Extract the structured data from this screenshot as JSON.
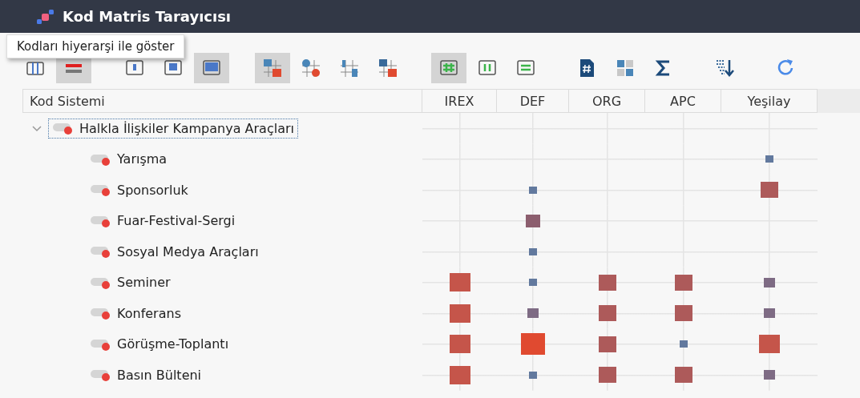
{
  "window": {
    "title": "Kod Matris Tarayıcısı"
  },
  "tooltip": "Kodları hiyerarşi ile göster",
  "toolbar": [
    {
      "kind": "columns",
      "selected": false
    },
    {
      "kind": "redlines",
      "selected": true
    },
    {
      "kind": "gap"
    },
    {
      "kind": "sq1",
      "selected": false
    },
    {
      "kind": "sq2",
      "selected": false
    },
    {
      "kind": "sq3",
      "selected": true
    },
    {
      "kind": "gap"
    },
    {
      "kind": "squares",
      "selected": true
    },
    {
      "kind": "circles",
      "selected": false
    },
    {
      "kind": "numbers",
      "selected": false
    },
    {
      "kind": "numsq",
      "selected": false
    },
    {
      "kind": "gap"
    },
    {
      "kind": "hash",
      "selected": true
    },
    {
      "kind": "pause",
      "selected": false
    },
    {
      "kind": "equals",
      "selected": false
    },
    {
      "kind": "gap"
    },
    {
      "kind": "doc",
      "selected": false
    },
    {
      "kind": "grid",
      "selected": false
    },
    {
      "kind": "sigma",
      "selected": false
    },
    {
      "kind": "gap"
    },
    {
      "kind": "sort",
      "selected": false
    },
    {
      "kind": "gap"
    },
    {
      "kind": "refresh",
      "selected": false
    }
  ],
  "table": {
    "name_header": "Kod Sistemi",
    "columns": [
      "IREX",
      "DEF",
      "ORG",
      "APC",
      "Yeşilay"
    ],
    "root": {
      "label": "Halkla İlişkiler Kampanya Araçları",
      "expanded": true,
      "children": [
        {
          "label": "Yarışma",
          "cells": [
            null,
            null,
            null,
            null,
            {
              "kind": "xs",
              "color": "#62799e"
            }
          ]
        },
        {
          "label": "Sponsorluk",
          "cells": [
            null,
            {
              "kind": "xs",
              "color": "#62799e"
            },
            null,
            null,
            {
              "kind": "l",
              "color": "#ad5a5a"
            }
          ]
        },
        {
          "label": "Fuar-Festival-Sergi",
          "cells": [
            null,
            {
              "kind": "m",
              "color": "#8c5e6e"
            },
            null,
            null,
            null
          ]
        },
        {
          "label": "Sosyal Medya Araçları",
          "cells": [
            null,
            {
              "kind": "xs",
              "color": "#62799e"
            },
            null,
            null,
            null
          ]
        },
        {
          "label": "Seminer",
          "cells": [
            {
              "kind": "xl",
              "color": "#c5554a"
            },
            {
              "kind": "xs",
              "color": "#62799e"
            },
            {
              "kind": "l",
              "color": "#ad5a5a"
            },
            {
              "kind": "l",
              "color": "#ad5a5a"
            },
            {
              "kind": "s",
              "color": "#7e6b84"
            }
          ]
        },
        {
          "label": "Konferans",
          "cells": [
            {
              "kind": "xl",
              "color": "#c5554a"
            },
            {
              "kind": "s",
              "color": "#7e6b84"
            },
            {
              "kind": "l",
              "color": "#ad5a5a"
            },
            {
              "kind": "l",
              "color": "#ad5a5a"
            },
            {
              "kind": "s",
              "color": "#7e6b84"
            }
          ]
        },
        {
          "label": "Görüşme-Toplantı",
          "cells": [
            {
              "kind": "xl",
              "color": "#c5554a"
            },
            {
              "kind": "xxl",
              "color": "#e04a30"
            },
            {
              "kind": "l",
              "color": "#ad5a5a"
            },
            {
              "kind": "xs",
              "color": "#62799e"
            },
            {
              "kind": "xl",
              "color": "#c5554a"
            }
          ]
        },
        {
          "label": "Basın Bülteni",
          "cells": [
            {
              "kind": "xl",
              "color": "#c5554a"
            },
            {
              "kind": "xs",
              "color": "#62799e"
            },
            {
              "kind": "l",
              "color": "#ad5a5a"
            },
            {
              "kind": "l",
              "color": "#ad5a5a"
            },
            {
              "kind": "s",
              "color": "#7e6b84"
            }
          ]
        }
      ]
    }
  }
}
